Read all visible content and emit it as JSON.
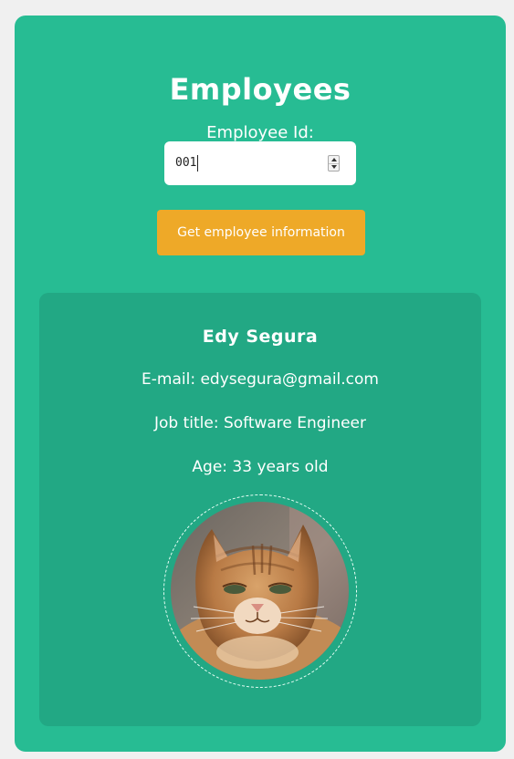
{
  "header": {
    "title": "Employees",
    "id_label": "Employee Id:"
  },
  "employee_id_field": {
    "value": "001"
  },
  "get_button": {
    "label": "Get employee information"
  },
  "employee": {
    "name": "Edy Segura",
    "email_line": "E-mail: edysegura@gmail.com",
    "job_line": "Job title: Software Engineer",
    "age_line": "Age: 33 years old",
    "photo": "cat-photo"
  },
  "colors": {
    "card_background": "#27bc93",
    "panel_background": "#22a884",
    "button_background": "#eea928",
    "page_background": "#f0f0f0",
    "text": "#ffffff"
  }
}
